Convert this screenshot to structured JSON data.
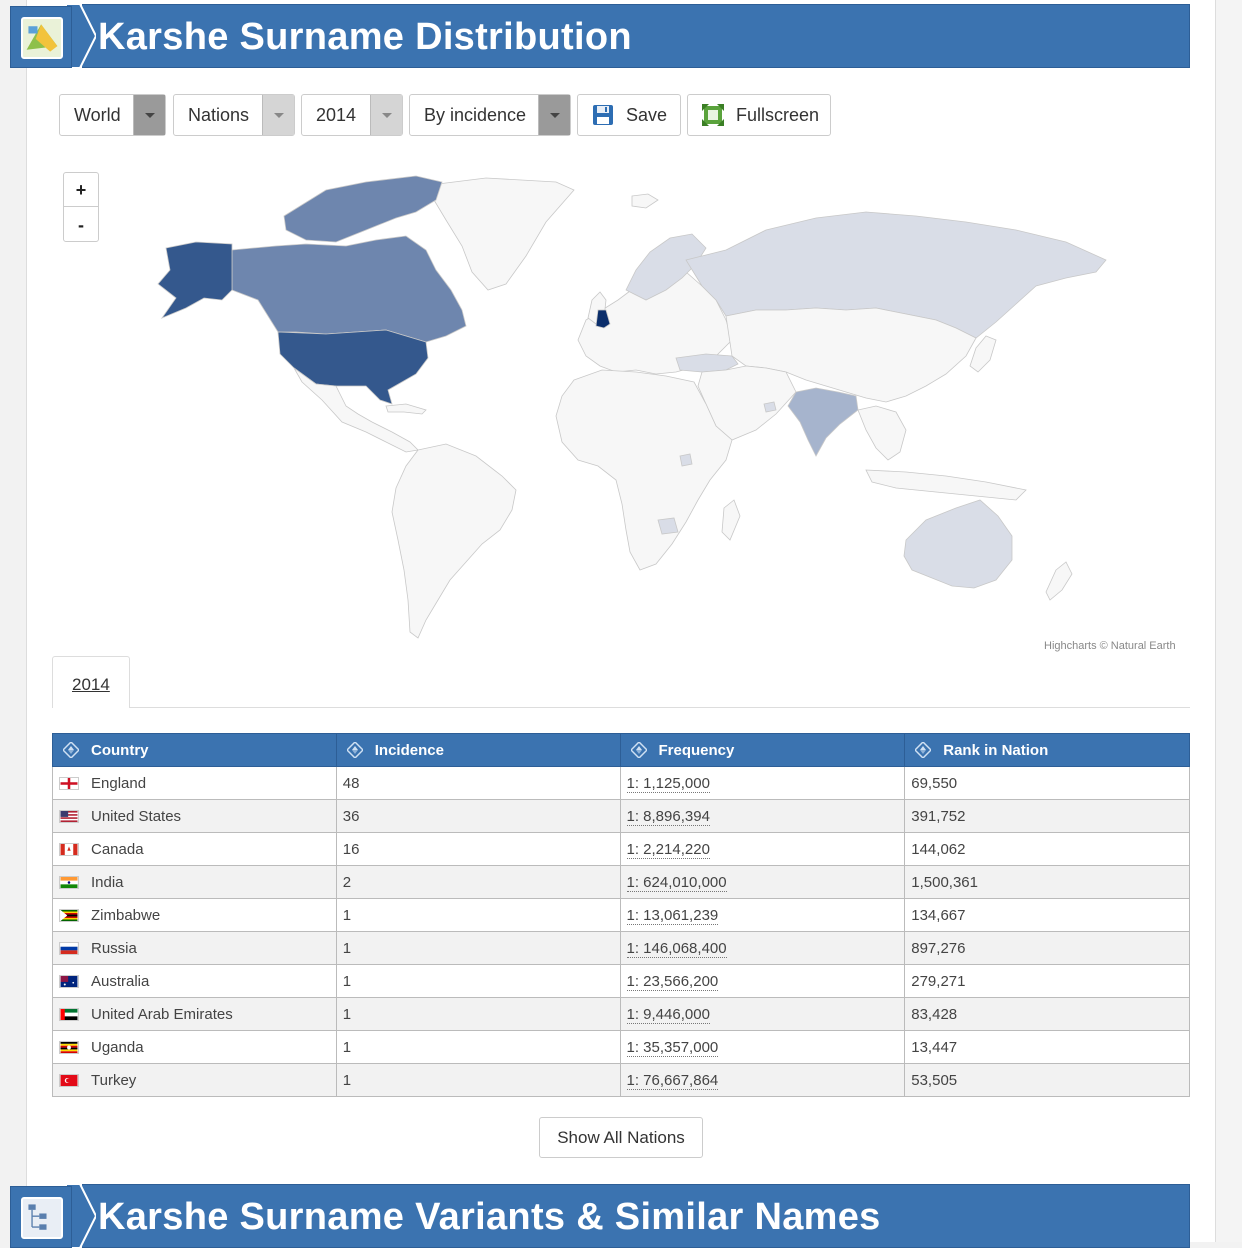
{
  "distribution": {
    "title": "Karshe Surname Distribution"
  },
  "controls": {
    "region": "World",
    "level": "Nations",
    "year": "2014",
    "metric": "By incidence",
    "save_label": "Save",
    "fullscreen_label": "Fullscreen"
  },
  "map": {
    "zoom_in": "+",
    "zoom_out": "-",
    "credits": "Highcharts © Natural Earth",
    "highlighted_countries": [
      {
        "name": "England",
        "color": "#0b2e6b"
      },
      {
        "name": "United States",
        "color": "#34588d"
      },
      {
        "name": "Alaska",
        "color": "#34588d"
      },
      {
        "name": "Canada",
        "color": "#6e86ae"
      },
      {
        "name": "India",
        "color": "#a6b4cd"
      },
      {
        "name": "Russia",
        "color": "#d9dde7"
      },
      {
        "name": "Australia",
        "color": "#d9dde7"
      },
      {
        "name": "Zimbabwe",
        "color": "#d9dde7"
      },
      {
        "name": "Uganda",
        "color": "#d9dde7"
      },
      {
        "name": "United Arab Emirates",
        "color": "#d9dde7"
      },
      {
        "name": "Turkey",
        "color": "#d9dde7"
      }
    ]
  },
  "tab": {
    "label": "2014"
  },
  "table": {
    "headers": {
      "country": "Country",
      "incidence": "Incidence",
      "frequency": "Frequency",
      "rank": "Rank in Nation"
    },
    "rows": [
      {
        "country": "England",
        "incidence": "48",
        "frequency": "1: 1,125,000",
        "rank": "69,550",
        "flag": "england"
      },
      {
        "country": "United States",
        "incidence": "36",
        "frequency": "1: 8,896,394",
        "rank": "391,752",
        "flag": "usa"
      },
      {
        "country": "Canada",
        "incidence": "16",
        "frequency": "1: 2,214,220",
        "rank": "144,062",
        "flag": "canada"
      },
      {
        "country": "India",
        "incidence": "2",
        "frequency": "1: 624,010,000",
        "rank": "1,500,361",
        "flag": "india"
      },
      {
        "country": "Zimbabwe",
        "incidence": "1",
        "frequency": "1: 13,061,239",
        "rank": "134,667",
        "flag": "zimbabwe"
      },
      {
        "country": "Russia",
        "incidence": "1",
        "frequency": "1: 146,068,400",
        "rank": "897,276",
        "flag": "russia"
      },
      {
        "country": "Australia",
        "incidence": "1",
        "frequency": "1: 23,566,200",
        "rank": "279,271",
        "flag": "australia"
      },
      {
        "country": "United Arab Emirates",
        "incidence": "1",
        "frequency": "1: 9,446,000",
        "rank": "83,428",
        "flag": "uae"
      },
      {
        "country": "Uganda",
        "incidence": "1",
        "frequency": "1: 35,357,000",
        "rank": "13,447",
        "flag": "uganda"
      },
      {
        "country": "Turkey",
        "incidence": "1",
        "frequency": "1: 76,667,864",
        "rank": "53,505",
        "flag": "turkey"
      }
    ]
  },
  "show_all_label": "Show All Nations",
  "variants": {
    "title": "Karshe Surname Variants & Similar Names"
  },
  "colors": {
    "header_blue": "#3b73b0",
    "land_default": "#f7f7f7",
    "land_border": "#c8c8c8"
  }
}
